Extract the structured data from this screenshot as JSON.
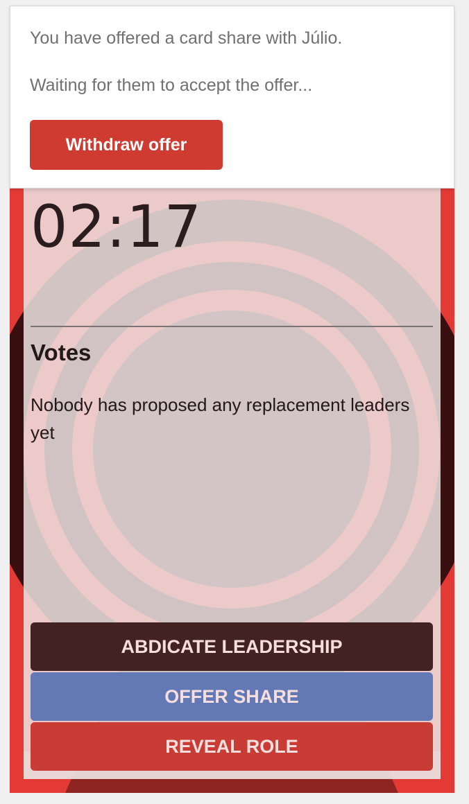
{
  "popup": {
    "offer_message": "You have offered a card share with Júlio.",
    "waiting_message": "Waiting for them to accept the offer...",
    "withdraw_label": "Withdraw offer"
  },
  "timer": {
    "value": "02:17"
  },
  "votes": {
    "heading": "Votes",
    "message": "Nobody has proposed any replacement leaders yet"
  },
  "actions": {
    "abdicate_label": "Abdicate leadership",
    "offer_share_label": "Offer share",
    "reveal_role_label": "Reveal role"
  },
  "colors": {
    "background_red": "#e33a35",
    "withdraw_button": "#cf3a31",
    "abdicate_button": "#432222",
    "offer_share_button": "#6379b6",
    "reveal_role_button": "#c93c36"
  }
}
